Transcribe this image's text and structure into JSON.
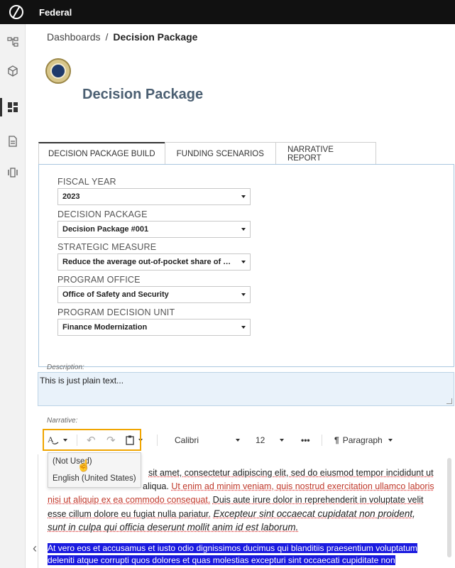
{
  "app": {
    "title": "Federal"
  },
  "sidebar": {
    "items": [
      {
        "icon": "hierarchy-icon"
      },
      {
        "icon": "cube-icon"
      },
      {
        "icon": "dashboard-icon",
        "active": true
      },
      {
        "icon": "document-icon"
      },
      {
        "icon": "carousel-icon"
      }
    ]
  },
  "breadcrumb": {
    "parent": "Dashboards",
    "separator": "/",
    "current": "Decision Package"
  },
  "page": {
    "title": "Decision Package"
  },
  "tabs": [
    {
      "label": "DECISION PACKAGE BUILD",
      "active": true
    },
    {
      "label": "FUNDING SCENARIOS"
    },
    {
      "label": "NARRATIVE REPORT"
    }
  ],
  "form": {
    "fiscal_year": {
      "label": "FISCAL YEAR",
      "value": "2023"
    },
    "decision_package": {
      "label": "DECISION PACKAGE",
      "value": "Decision Package #001"
    },
    "strategic_measure": {
      "label": "STRATEGIC MEASURE",
      "value": "Reduce the average out-of-pocket share of pre..."
    },
    "program_office": {
      "label": "PROGRAM OFFICE",
      "value": "Office of Safety and Security"
    },
    "program_decision_unit": {
      "label": "PROGRAM DECISION UNIT",
      "value": "Finance Modernization"
    }
  },
  "description": {
    "label": "Description:",
    "value": "This is just plain text..."
  },
  "narrative": {
    "label": "Narrative:",
    "toolbar": {
      "font": "Calibri",
      "size": "12",
      "more": "•••",
      "paragraph": "Paragraph"
    },
    "language_menu": [
      "(Not Used)",
      "English (United States)"
    ],
    "text": {
      "p1_line1": "sit amet, consectetur adipiscing elit, sed do eiusmod tempor incididunt ut",
      "p1_line2a": "aliqua.",
      "p1_line2b": "Ut enim ad minim veniam, quis nostrud exercitation ullamco laboris",
      "p1_line3a": "nisi ut aliquip ex ea commodo consequat.",
      "p1_line3b": "Duis aute irure dolor in reprehenderit in voluptate velit",
      "p1_line4a": "esse cillum dolore eu fugiat nulla pariatur.",
      "p1_line4b": "Excepteur sint occaecat cupidatat non proident,",
      "p1_line5": "sunt in culpa qui officia deserunt mollit anim id est laborum.",
      "p2_line1": "At vero eos et accusamus et iusto odio dignissimos ducimus qui blanditiis praesentium voluptatum",
      "p2_line2": "deleniti atque corrupti quos dolores et quas molestias excepturi sint occaecati cupiditate non"
    }
  },
  "colors": {
    "highlight": "#f0a500",
    "selection": "#1a1adf",
    "title": "#4b5f72"
  }
}
